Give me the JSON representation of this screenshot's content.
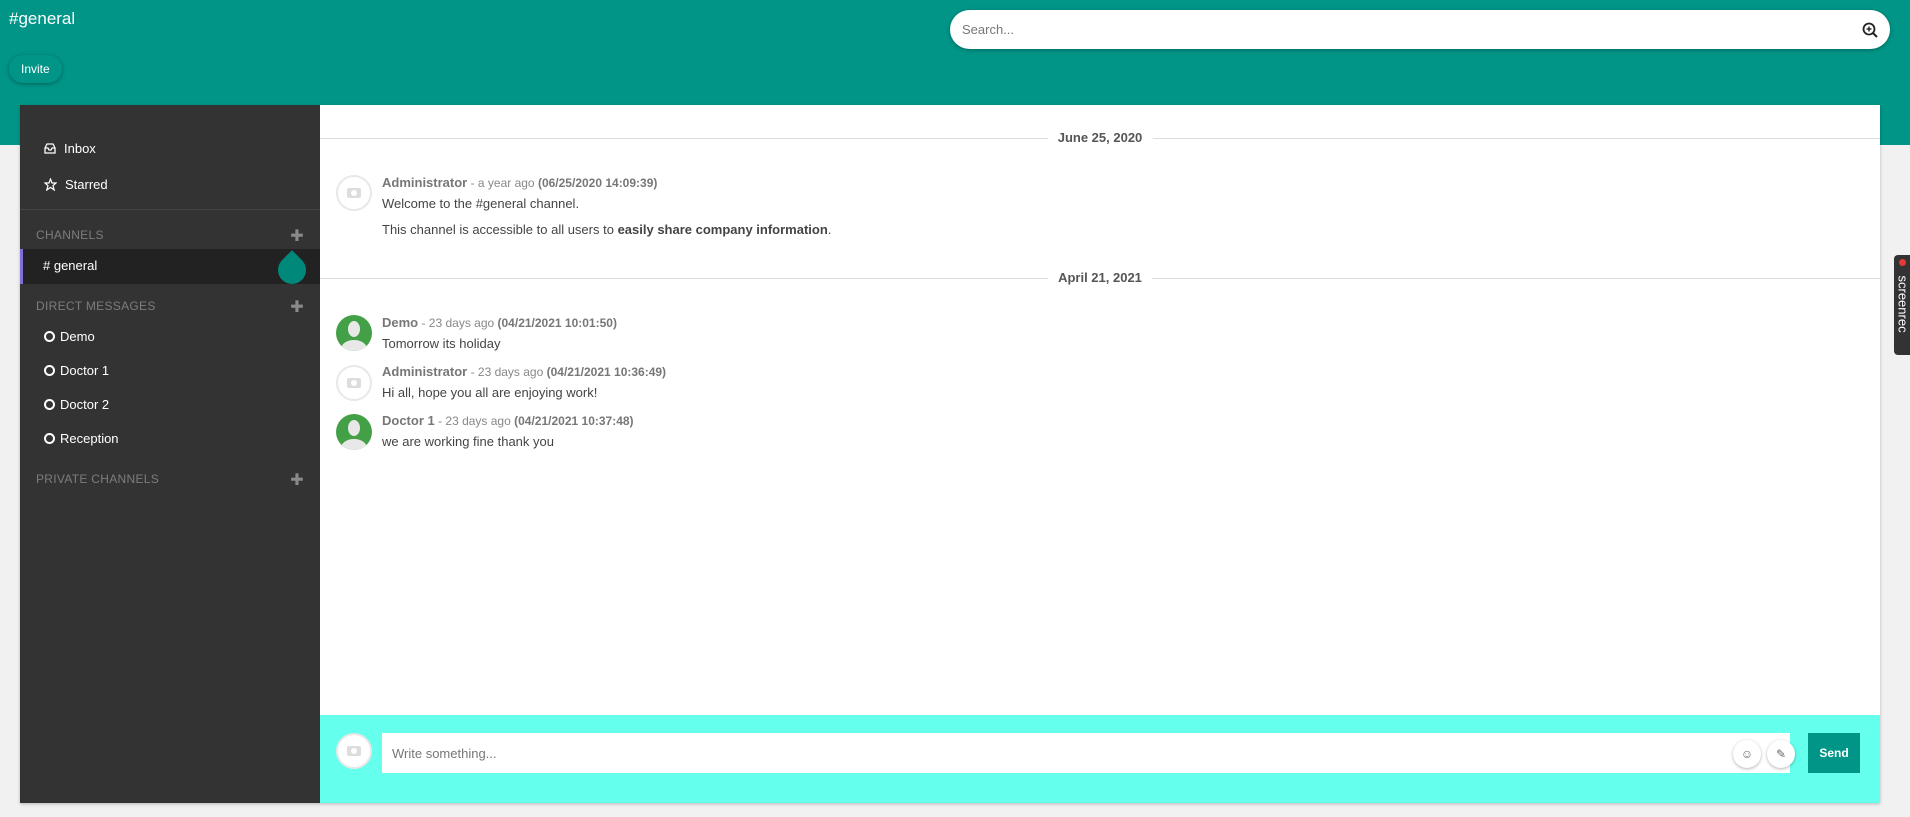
{
  "header": {
    "channel_title": "#general",
    "invite_label": "Invite",
    "search_placeholder": "Search..."
  },
  "sidebar": {
    "inbox_label": "Inbox",
    "starred_label": "Starred",
    "channels_heading": "CHANNELS",
    "active_channel": "# general",
    "direct_messages_heading": "DIRECT MESSAGES",
    "direct_messages": [
      "Demo",
      "Doctor 1",
      "Doctor 2",
      "Reception"
    ],
    "private_channels_heading": "PRIVATE CHANNELS"
  },
  "conversation": {
    "dates": [
      "June 25, 2020",
      "April 21, 2021"
    ],
    "messages": [
      {
        "author": "Administrator",
        "ago": " - a year ago ",
        "stamp": "(06/25/2020 14:09:39)",
        "lines": [
          "Welcome to the #general channel."
        ],
        "line2_prefix": "This channel is accessible to all users to ",
        "line2_bold": "easily share company information",
        "line2_suffix": "."
      },
      {
        "author": "Demo",
        "ago": " - 23 days ago ",
        "stamp": "(04/21/2021 10:01:50)",
        "text": "Tomorrow its holiday"
      },
      {
        "author": "Administrator",
        "ago": " - 23 days ago ",
        "stamp": "(04/21/2021 10:36:49)",
        "text": "Hi all, hope you all are enjoying work!"
      },
      {
        "author": "Doctor 1",
        "ago": " - 23 days ago ",
        "stamp": "(04/21/2021 10:37:48)",
        "text": "we are working fine thank you"
      }
    ]
  },
  "composer": {
    "placeholder": "Write something...",
    "emoji_glyph": "☺",
    "attach_glyph": "✎",
    "send_label": "Send"
  },
  "overlay": {
    "screenrec_label": "screenrec"
  },
  "colors": {
    "brand": "#009587",
    "sidebar": "#333333",
    "composer": "#64ffed"
  }
}
